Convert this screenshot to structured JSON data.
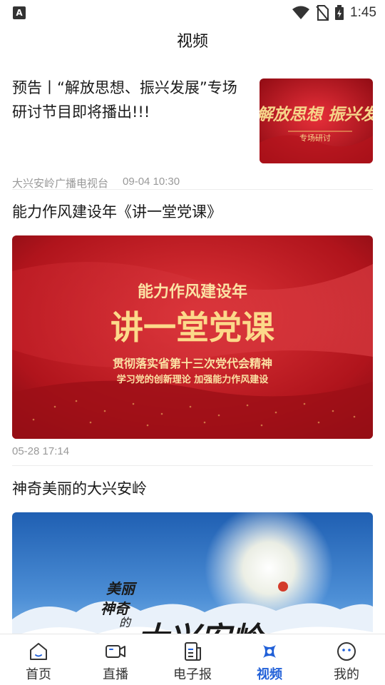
{
  "status_bar": {
    "time": "1:45",
    "left_icon": "A"
  },
  "header": {
    "title": "视频"
  },
  "feed": {
    "items": [
      {
        "title": "预告丨“解放思想、振兴发展”专场研讨节目即将播出!!!",
        "source": "大兴安岭广播电视台",
        "time": "09-04 10:30",
        "thumb_text_main": "解放思想 振兴发展",
        "thumb_text_sub": "专场研讨"
      },
      {
        "title": "能力作风建设年《讲一堂党课》",
        "time": "05-28 17:14",
        "cover_line1": "能力作风建设年",
        "cover_line2": "讲一堂党课",
        "cover_line3": "贯彻落实省第十三次党代会精神",
        "cover_line4": "学习党的创新理论  加强能力作风建设"
      },
      {
        "title": "神奇美丽的大兴安岭",
        "cover_line1": "美丽",
        "cover_line2": "神奇",
        "cover_line3": "的",
        "cover_line4": "大兴安岭"
      }
    ]
  },
  "tabbar": {
    "tabs": [
      {
        "label": "首页",
        "icon": "home-icon"
      },
      {
        "label": "直播",
        "icon": "video-camera-icon"
      },
      {
        "label": "电子报",
        "icon": "newspaper-icon"
      },
      {
        "label": "视频",
        "icon": "video-icon",
        "active": true
      },
      {
        "label": "我的",
        "icon": "profile-icon"
      }
    ],
    "active_color": "#2160d8"
  }
}
